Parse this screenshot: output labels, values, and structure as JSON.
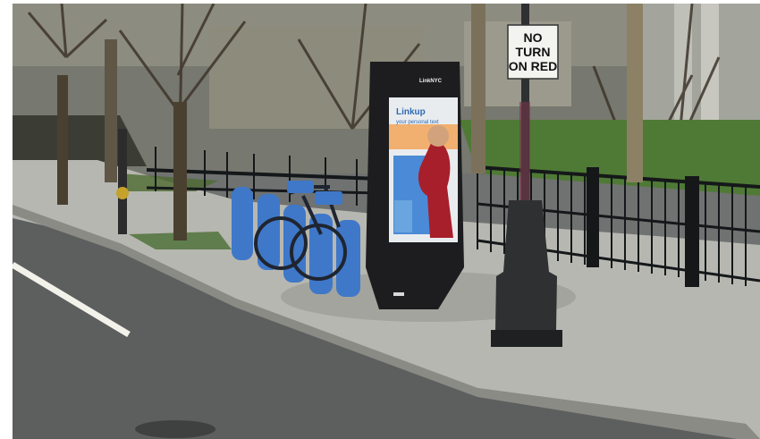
{
  "scene": {
    "type": "street photo mockup",
    "street_sign": {
      "line1": "NO",
      "line2": "TURN",
      "line3": "ON RED"
    },
    "kiosk": {
      "brand_text": "LinkNYC",
      "screen_headline": "Linkup",
      "screen_subline": "your personal text"
    },
    "colors": {
      "bike_dock_blue": "#3f78c9",
      "kiosk_black": "#1d1d1f",
      "grass_green": "#4f7a35",
      "road_gray": "#5d5f5f",
      "sidewalk": "#b7b7b1"
    }
  }
}
